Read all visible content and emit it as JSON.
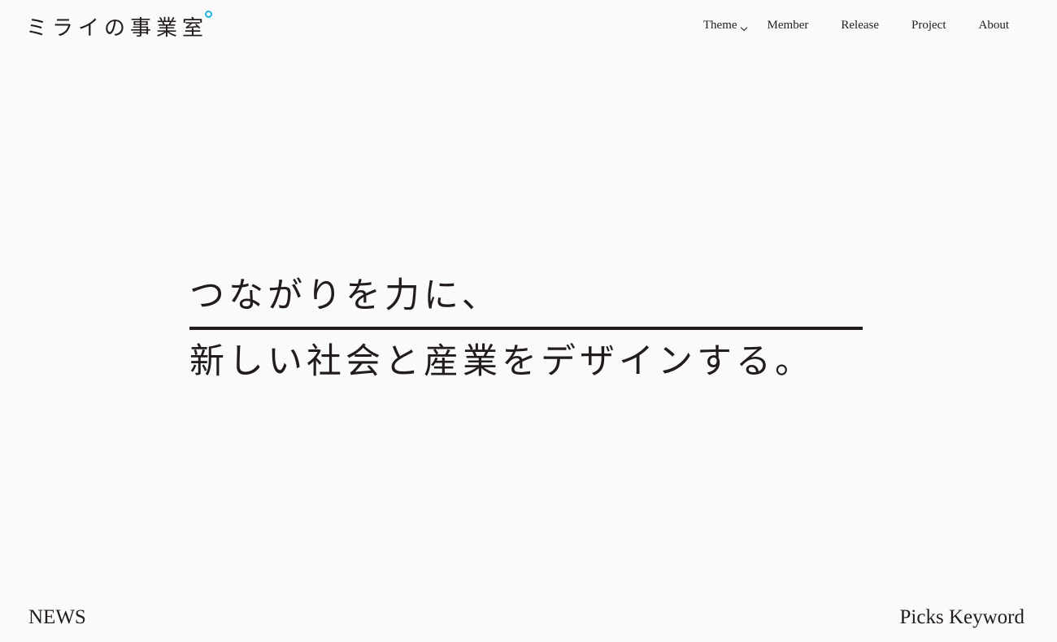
{
  "header": {
    "logo_text": "ミライの事業室",
    "logo_accent_color": "#22b6e6"
  },
  "nav": {
    "items": [
      {
        "label": "Theme",
        "has_dropdown": true
      },
      {
        "label": "Member"
      },
      {
        "label": "Release"
      },
      {
        "label": "Project"
      },
      {
        "label": "About"
      }
    ]
  },
  "hero": {
    "line1": "つながりを力に、",
    "line2": "新しい社会と産業をデザインする。"
  },
  "sections": {
    "news_label": "NEWS",
    "picks_keyword_label": "Picks Keyword"
  },
  "colors": {
    "background": "#fafafa",
    "text": "#231c1c",
    "accent": "#22b6e6"
  },
  "icons": {
    "theme_dropdown": "chevron-down-icon",
    "logo_mark": "circle-icon"
  }
}
